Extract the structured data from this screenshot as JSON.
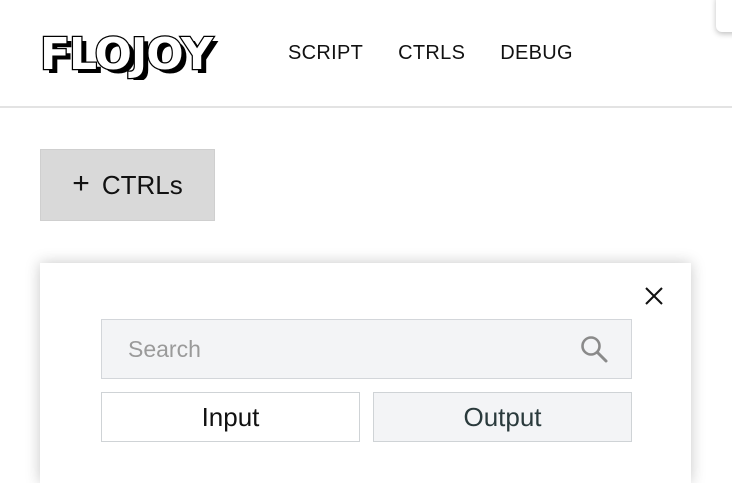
{
  "header": {
    "logo_text": "FLOJOY",
    "nav": [
      {
        "label": "SCRIPT"
      },
      {
        "label": "CTRLS"
      },
      {
        "label": "DEBUG"
      }
    ]
  },
  "toolbar": {
    "add_button_label": "CTRLs",
    "add_button_icon": "plus-icon"
  },
  "modal": {
    "close_icon": "close-icon",
    "search": {
      "placeholder": "Search",
      "value": "",
      "icon": "search-icon"
    },
    "tabs": [
      {
        "label": "Input",
        "selected": true
      },
      {
        "label": "Output",
        "selected": false
      }
    ]
  },
  "colors": {
    "button_bg": "#d9d9d9",
    "search_bg": "#f3f4f6",
    "tab_output_bg": "#f3f4f6",
    "header_divider": "#e3e3e3"
  }
}
